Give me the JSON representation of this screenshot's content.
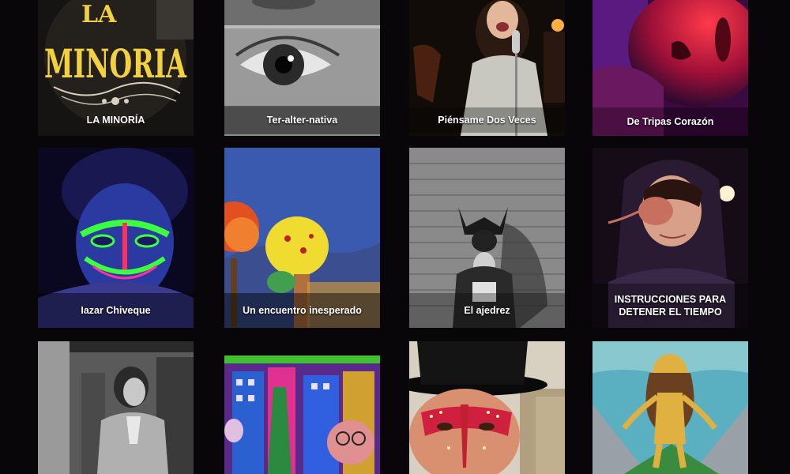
{
  "gallery": {
    "items": [
      {
        "title": "LA MINORÍA",
        "logo_top": "LA",
        "logo_main": "MINORIA"
      },
      {
        "title": "Ter-alter-nativa"
      },
      {
        "title": "Piénsame Dos Veces"
      },
      {
        "title": "De Tripas Corazón"
      },
      {
        "title": "Iazar Chiveque"
      },
      {
        "title": "Un encuentro inesperado"
      },
      {
        "title": "El ajedrez"
      },
      {
        "title": "INSTRUCCIONES PARA DETENER EL TIEMPO"
      },
      {
        "title": ""
      },
      {
        "title": ""
      },
      {
        "title": ""
      },
      {
        "title": ""
      }
    ]
  },
  "colors": {
    "background": "#080608",
    "caption_overlay": "rgba(0,0,0,0.45)",
    "logo_yellow": "#f2d040"
  }
}
